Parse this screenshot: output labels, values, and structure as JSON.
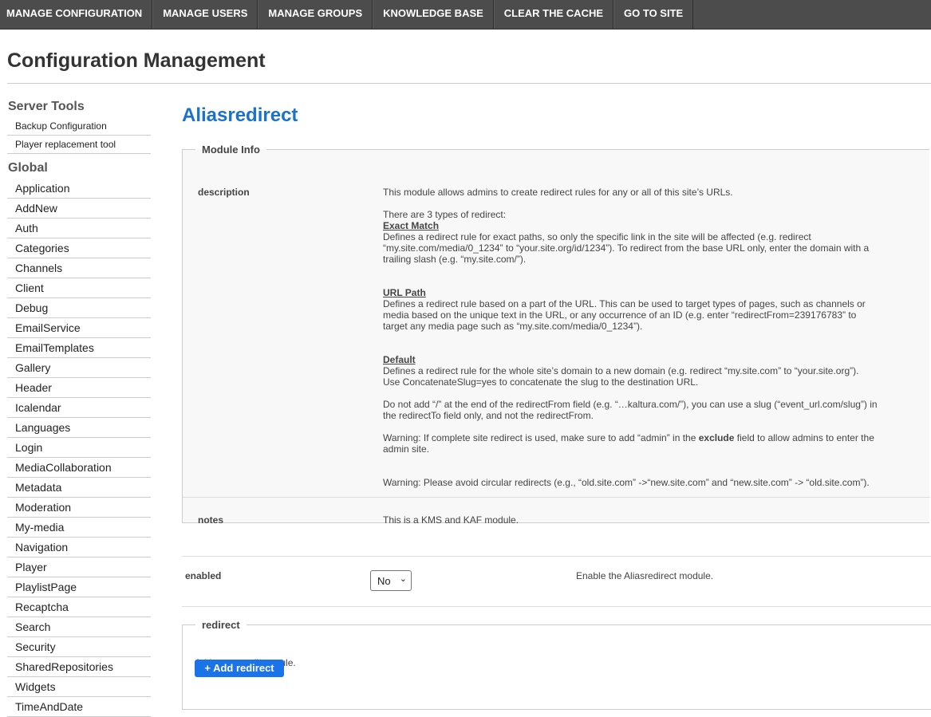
{
  "topnav": [
    "MANAGE CONFIGURATION",
    "MANAGE USERS",
    "MANAGE GROUPS",
    "KNOWLEDGE BASE",
    "CLEAR THE CACHE",
    "GO TO SITE"
  ],
  "page_title": "Configuration Management",
  "sidebar": {
    "server_tools_heading": "Server Tools",
    "server_tools": [
      "Backup Configuration",
      "Player replacement tool"
    ],
    "global_heading": "Global",
    "global": [
      "Application",
      "AddNew",
      "Auth",
      "Categories",
      "Channels",
      "Client",
      "Debug",
      "EmailService",
      "EmailTemplates",
      "Gallery",
      "Header",
      "Icalendar",
      "Languages",
      "Login",
      "MediaCollaboration",
      "Metadata",
      "Moderation",
      "My-media",
      "Navigation",
      "Player",
      "PlaylistPage",
      "Recaptcha",
      "Search",
      "Security",
      "SharedRepositories",
      "Widgets",
      "TimeAndDate"
    ]
  },
  "module": {
    "title": "Aliasredirect",
    "info_legend": "Module Info",
    "description_label": "description",
    "desc": {
      "intro": "This module allows admins to create redirect rules for any or all of this site’s URLs.",
      "types": "There are 3 types of redirect:",
      "exact_title": "Exact Match",
      "exact_body": "Defines a redirect rule for exact paths, so only the specific link in the site will be affected (e.g. redirect “my.site.com/media/0_1234” to “your.site.org/id/1234”). To redirect from the base URL only, enter the domain with a trailing slash (e.g. “my.site.com/”).",
      "path_title": "URL Path",
      "path_body": "Defines a redirect rule based on a part of the URL. This can be used to target types of pages, such as channels or media based on the unique text in the URL, or any occurrence of an ID (e.g. enter “redirectFrom=239176783” to target any media page such as “my.site.com/media/0_1234”).",
      "default_title": "Default",
      "default_body": "Defines a redirect rule for the whole site’s domain to a new domain (e.g. redirect “my.site.com” to “your.site.org”). Use ConcatenateSlug=yes to concatenate the slug to the destination URL.",
      "slash_note": "Do not add “/” at the end of the redirectFrom field (e.g. “…kaltura.com/”), you can use a slug (“event_url.com/slug”) in the redirectTo field only, and not the redirectFrom.",
      "warning1_pre": "Warning: If complete site redirect is used, make sure to add “admin” in the ",
      "warning1_bold": "exclude",
      "warning1_post": " field to allow admins to enter the admin site.",
      "warning2": "Warning: Please avoid circular redirects (e.g., “old.site.com” ->“new.site.com” and “new.site.com” -> “old.site.com”)."
    },
    "notes_label": "notes",
    "notes_text": "This is a KMS and KAF module.",
    "enabled_label": "enabled",
    "enabled_value": "No",
    "enabled_help": "Enable the Aliasredirect module.",
    "redirect_legend": "redirect",
    "redirect_help": "Add a new redirect rule.",
    "add_button": "+ Add redirect"
  }
}
